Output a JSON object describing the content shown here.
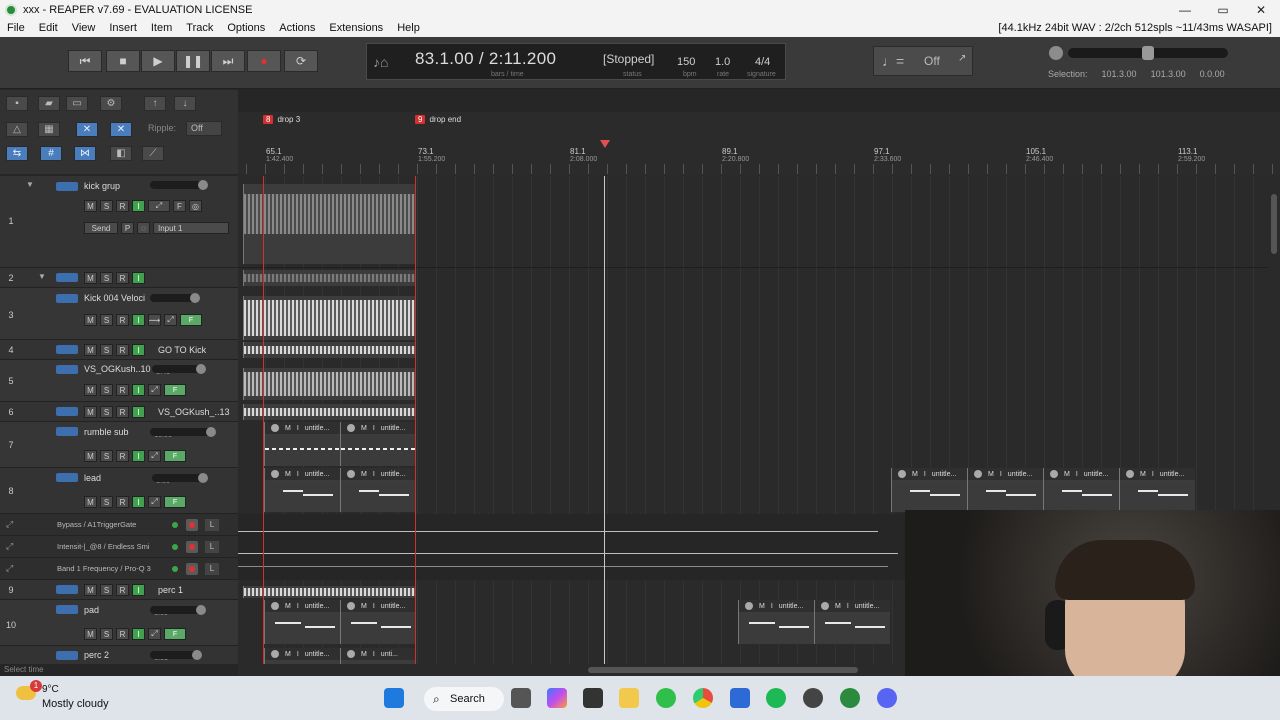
{
  "window": {
    "title": "xxx - REAPER v7.69 - EVALUATION LICENSE",
    "controls": [
      "—",
      "▭",
      "✕"
    ]
  },
  "menu": {
    "items": [
      "File",
      "Edit",
      "View",
      "Insert",
      "Item",
      "Track",
      "Options",
      "Actions",
      "Extensions",
      "Help"
    ],
    "audio_status": "[44.1kHz 24bit WAV : 2/2ch 512spls ~11/43ms WASAPI]"
  },
  "transport": {
    "position": "83.1.00 / 2:11.200",
    "position_sub": "bars / time",
    "state": "[Stopped]",
    "state_sub": "status",
    "bpm": "150",
    "bpm_sub": "bpm",
    "rate": "1.0",
    "rate_sub": "rate",
    "signature": "4/4",
    "signature_sub": "signature",
    "metronome_value": "Off",
    "selection_label": "Selection:",
    "selection_start": "101.3.00",
    "selection_end": "101.3.00",
    "selection_len": "0.0.00"
  },
  "toolbar": {
    "ripple_label": "Ripple:",
    "ripple_value": "Off"
  },
  "markers": [
    {
      "num": "8",
      "name": "drop 3"
    },
    {
      "num": "9",
      "name": "drop end"
    }
  ],
  "ruler": [
    {
      "bar": "65.1",
      "time": "1:42.400"
    },
    {
      "bar": "73.1",
      "time": "1:55.200"
    },
    {
      "bar": "81.1",
      "time": "2:08.000"
    },
    {
      "bar": "89.1",
      "time": "2:20.800"
    },
    {
      "bar": "97.1",
      "time": "2:33.600"
    },
    {
      "bar": "105.1",
      "time": "2:46.400"
    },
    {
      "bar": "113.1",
      "time": "2:59.200"
    }
  ],
  "tracks": [
    {
      "num": "1",
      "name": "kick grup",
      "vol": "0.00",
      "send": "Send",
      "input": "Input 1"
    },
    {
      "num": "2",
      "name": ""
    },
    {
      "num": "3",
      "name": "Kick 004 Veloci",
      "vol": "-6.10"
    },
    {
      "num": "4",
      "name": "GO TO Kick"
    },
    {
      "num": "5",
      "name": "VS_OGKush..10",
      "vol": "-2.41"
    },
    {
      "num": "6",
      "name": "VS_OGKush_..13"
    },
    {
      "num": "7",
      "name": "rumble sub",
      "vol": "-18.06"
    },
    {
      "num": "8",
      "name": "lead",
      "vol": "-2.00"
    },
    {
      "num": "9",
      "name": "perc 1"
    },
    {
      "num": "10",
      "name": "pad",
      "vol": "-3.09"
    },
    {
      "num": "",
      "name": "perc 2",
      "vol": "-6.51"
    }
  ],
  "envelopes": [
    "Bypass / A1TriggerGate",
    "Intensit-|_@8 / Endless Smi",
    "Band 1 Frequency / Pro-Q 3"
  ],
  "track_buttons": {
    "m": "M",
    "s": "S",
    "r": "R",
    "i": "I",
    "p": "P",
    "l": "L",
    "fx": "F"
  },
  "item_label": "untitle...",
  "item_label_short": "unti...",
  "statusbar": "Select time",
  "taskbar": {
    "temp": "9°C",
    "weather": "Mostly cloudy",
    "badge": "1",
    "search": "Search"
  }
}
